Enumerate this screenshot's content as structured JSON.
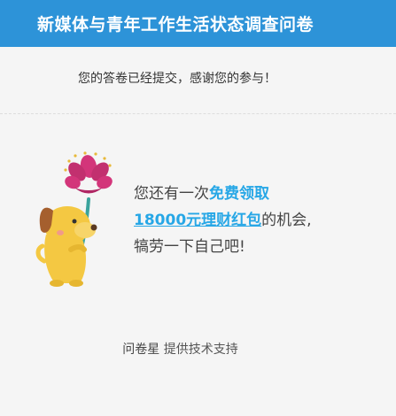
{
  "header": {
    "title": "新媒体与青年工作生活状态调查问卷",
    "background_color": "#2d93d8"
  },
  "confirmation": {
    "message": "您的答卷已经提交，感谢您的参与！"
  },
  "promo": {
    "text_prefix": "您还有一次",
    "highlight_1": "免费领取",
    "highlight_2": "18000元理财红包",
    "text_middle": "的机会,",
    "text_last": "犒劳一下自己吧!",
    "highlight_color": "#27a7e6"
  },
  "mascot": {
    "icon": "dog-with-flower-icon"
  },
  "footer": {
    "brand": "问卷星",
    "text": "提供技术支持"
  }
}
